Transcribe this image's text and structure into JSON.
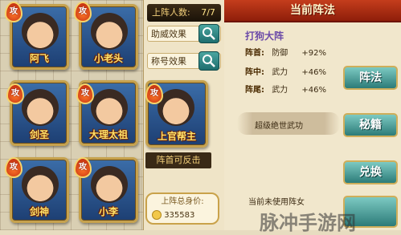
{
  "team": {
    "slots": [
      {
        "name": "阿飞",
        "badge": "攻"
      },
      {
        "name": "小老头",
        "badge": "攻"
      },
      {
        "name": "剑圣",
        "badge": "攻"
      },
      {
        "name": "大理太祖",
        "badge": "攻"
      },
      {
        "name": "上官帮主",
        "badge": "攻"
      },
      {
        "name": "剑神",
        "badge": "攻"
      },
      {
        "name": "小李",
        "badge": "攻"
      }
    ],
    "counter_label": "上阵人数:",
    "counter_value": "7/7",
    "assist_label": "助威效果",
    "title_label": "称号效果",
    "counter_attack": "阵首可反击",
    "total_label": "上阵总身价:",
    "total_value": "335583"
  },
  "formation": {
    "header": "当前阵法",
    "name": "打狗大阵",
    "stats": [
      {
        "pos": "阵首:",
        "attr": "防御",
        "val": "+92%"
      },
      {
        "pos": "阵中:",
        "attr": "武力",
        "val": "+46%"
      },
      {
        "pos": "阵尾:",
        "attr": "武力",
        "val": "+46%"
      }
    ],
    "skill": "超级绝世武功",
    "btn_formation": "阵法",
    "btn_secret": "秘籍",
    "btn_exchange": "兑换",
    "footer_hint": "当前未使用阵女",
    "watermark": "脉冲手游网"
  }
}
